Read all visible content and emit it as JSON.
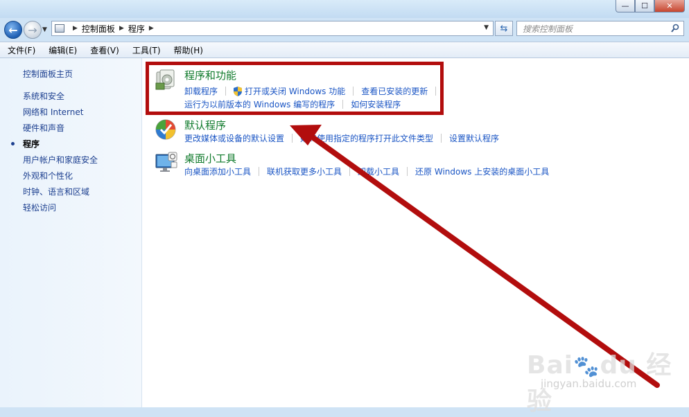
{
  "window": {
    "min_label": "—",
    "max_label": "☐",
    "close_label": "✕"
  },
  "address": {
    "crumbs": [
      "控制面板",
      "程序"
    ],
    "search_placeholder": "搜索控制面板"
  },
  "menu": [
    "文件(F)",
    "编辑(E)",
    "查看(V)",
    "工具(T)",
    "帮助(H)"
  ],
  "sidebar": {
    "home": "控制面板主页",
    "items": [
      {
        "label": "系统和安全",
        "current": false
      },
      {
        "label": "网络和 Internet",
        "current": false
      },
      {
        "label": "硬件和声音",
        "current": false
      },
      {
        "label": "程序",
        "current": true
      },
      {
        "label": "用户帐户和家庭安全",
        "current": false
      },
      {
        "label": "外观和个性化",
        "current": false
      },
      {
        "label": "时钟、语言和区域",
        "current": false
      },
      {
        "label": "轻松访问",
        "current": false
      }
    ]
  },
  "categories": [
    {
      "title": "程序和功能",
      "icon": "programs-features-icon",
      "links_row1": [
        "卸载程序",
        "打开或关闭 Windows 功能",
        "查看已安装的更新"
      ],
      "links_row2": [
        "运行为以前版本的 Windows 编写的程序",
        "如何安装程序"
      ]
    },
    {
      "title": "默认程序",
      "icon": "default-programs-icon",
      "links_row1": [
        "更改媒体或设备的默认设置",
        "始终使用指定的程序打开此文件类型",
        "设置默认程序"
      ]
    },
    {
      "title": "桌面小工具",
      "icon": "desktop-gadgets-icon",
      "links_row1": [
        "向桌面添加小工具",
        "联机获取更多小工具",
        "卸载小工具",
        "还原 Windows 上安装的桌面小工具"
      ]
    }
  ],
  "annotation_color": "#b20d0d",
  "watermark": {
    "logo": "Baidu经验",
    "url": "jingyan.baidu.com"
  }
}
